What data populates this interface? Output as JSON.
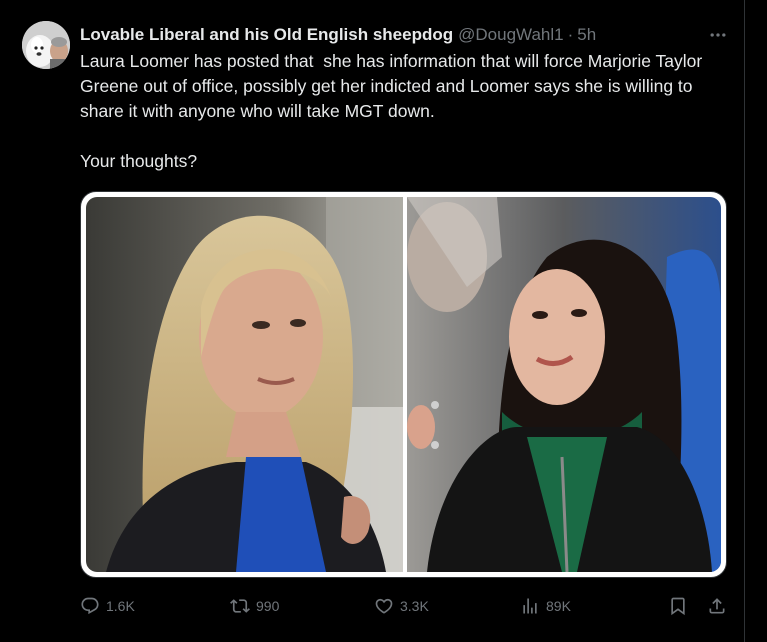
{
  "tweet": {
    "display_name": "Lovable Liberal and his Old English sheepdog",
    "handle": "@DougWahl1",
    "separator": "·",
    "time": "5h",
    "text": "Laura Loomer has posted that  she has information that will force Marjorie Taylor Greene out of office, possibly get her indicted and Loomer says she is willing to share it with anyone who will take MGT down.\n\nYour thoughts?",
    "media": [
      {
        "description_icon": "photo-woman-blonde"
      },
      {
        "description_icon": "photo-woman-dark-hair"
      }
    ],
    "actions": {
      "replies": "1.6K",
      "reposts": "990",
      "likes": "3.3K",
      "views": "89K"
    }
  },
  "colors": {
    "background": "#000000",
    "text": "#e7e9ea",
    "secondary": "#71767b",
    "border": "#2f3336"
  }
}
